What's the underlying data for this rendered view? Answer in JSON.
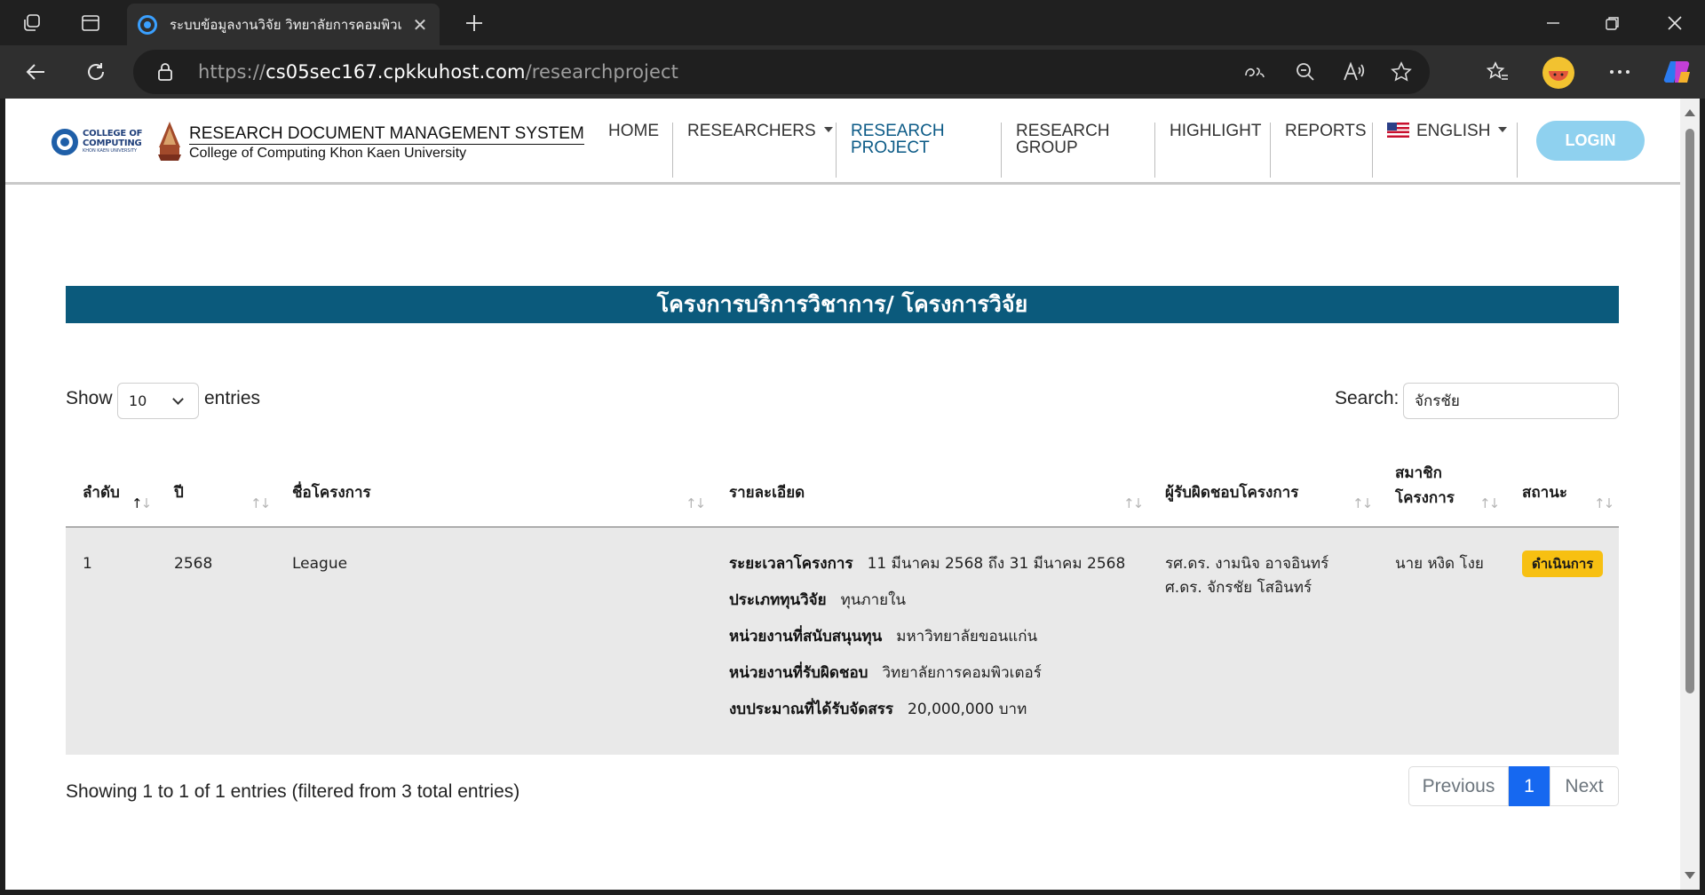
{
  "browser": {
    "tab_title": "ระบบข้อมูลงานวิจัย วิทยาลัยการคอมพิวเตอร์",
    "tab_close": "✕",
    "url_prefix": "https://",
    "url_host": "cs05sec167.cpkkuhost.com",
    "url_path": "/researchproject"
  },
  "site": {
    "logo_line1": "COLLEGE OF",
    "logo_line2": "COMPUTING",
    "logo_sub": "KHON KAEN UNIVERSITY",
    "title": "RESEARCH DOCUMENT MANAGEMENT SYSTEM",
    "subtitle": "College of Computing Khon Kaen University"
  },
  "nav": {
    "home": "HOME",
    "researchers": "RESEARCHERS",
    "research_project_1": "RESEARCH",
    "research_project_2": "PROJECT",
    "research_group_1": "RESEARCH",
    "research_group_2": "GROUP",
    "highlight": "HIGHLIGHT",
    "reports": "REPORTS",
    "language": "ENGLISH",
    "login": "LOGIN"
  },
  "banner": "โครงการบริการวิชาการ/ โครงการวิจัย",
  "controls": {
    "show_label": "Show",
    "entries_label": "entries",
    "length_value": "10",
    "search_label": "Search:",
    "search_value": "จักรชัย"
  },
  "table": {
    "headers": {
      "order": "ลำดับ",
      "year": "ปี",
      "name": "ชื่อโครงการ",
      "detail": "รายละเอียด",
      "owner": "ผู้รับผิดชอบโครงการ",
      "members_1": "สมาชิก",
      "members_2": "โครงการ",
      "status": "สถานะ"
    },
    "rows": [
      {
        "order": "1",
        "year": "2568",
        "name": "League",
        "details": [
          {
            "label": "ระยะเวลาโครงการ",
            "value": "11 มีนาคม 2568 ถึง 31 มีนาคม 2568"
          },
          {
            "label": "ประเภททุนวิจัย",
            "value": "ทุนภายใน"
          },
          {
            "label": "หน่วยงานที่สนับสนุนทุน",
            "value": "มหาวิทยาลัยขอนแก่น"
          },
          {
            "label": "หน่วยงานที่รับผิดชอบ",
            "value": "วิทยาลัยการคอมพิวเตอร์"
          },
          {
            "label": "งบประมาณที่ได้รับจัดสรร",
            "value": "20,000,000 บาท"
          }
        ],
        "owners": [
          "รศ.ดร. งามนิจ อาจอินทร์",
          "ศ.ดร. จักรชัย โสอินทร์"
        ],
        "member": "นาย หงิด โงย",
        "status": "ดำเนินการ"
      }
    ]
  },
  "footer": {
    "info": "Showing 1 to 1 of 1 entries (filtered from 3 total entries)",
    "previous": "Previous",
    "page": "1",
    "next": "Next"
  },
  "colors": {
    "banner": "#0b5a7c",
    "active_nav": "#0b5a86",
    "login": "#8fd1ef",
    "badge": "#f7c012",
    "page_active": "#1668f0"
  }
}
